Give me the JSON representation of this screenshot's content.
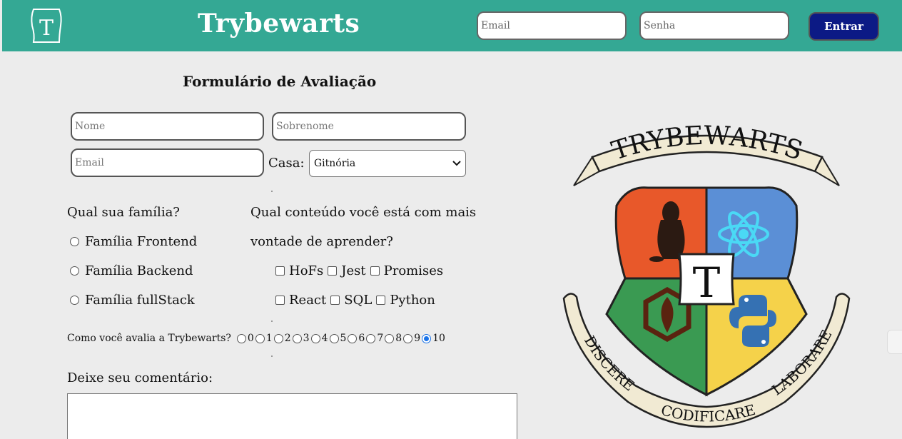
{
  "header": {
    "logo_letter": "T",
    "brand": "Trybewarts",
    "email_placeholder": "Email",
    "password_placeholder": "Senha",
    "login_button": "Entrar"
  },
  "form": {
    "title": "Formulário de Avaliação",
    "name_placeholder": "Nome",
    "lastname_placeholder": "Sobrenome",
    "email_placeholder": "Email",
    "house_label": "Casa:",
    "house_selected": "Gitnória",
    "family_question": "Qual sua família?",
    "families": [
      "Família Frontend",
      "Família Backend",
      "Família fullStack"
    ],
    "content_question_line1": "Qual conteúdo você está com mais",
    "content_question_line2": "vontade de aprender?",
    "contents_row1": [
      "HoFs",
      "Jest",
      "Promises"
    ],
    "contents_row2": [
      "React",
      "SQL",
      "Python"
    ],
    "rating_question": "Como você avalia a Trybewarts?",
    "rating_options": [
      "0",
      "1",
      "2",
      "3",
      "4",
      "5",
      "6",
      "7",
      "8",
      "9",
      "10"
    ],
    "rating_selected": "10",
    "comment_label": "Deixe seu comentário:"
  },
  "crest": {
    "top_banner": "TRYBEWARTS",
    "center_letter": "T",
    "banner_left": "DISCERE",
    "banner_bottom": "CODIFICARE",
    "banner_right": "LABORARE",
    "quarter_colors": [
      "#e8582a",
      "#5b8fd6",
      "#3a9a52",
      "#f5d24a"
    ]
  },
  "colors": {
    "header_bg": "#34a894",
    "login_button_bg": "#0c1a85",
    "page_bg": "#ececec"
  }
}
